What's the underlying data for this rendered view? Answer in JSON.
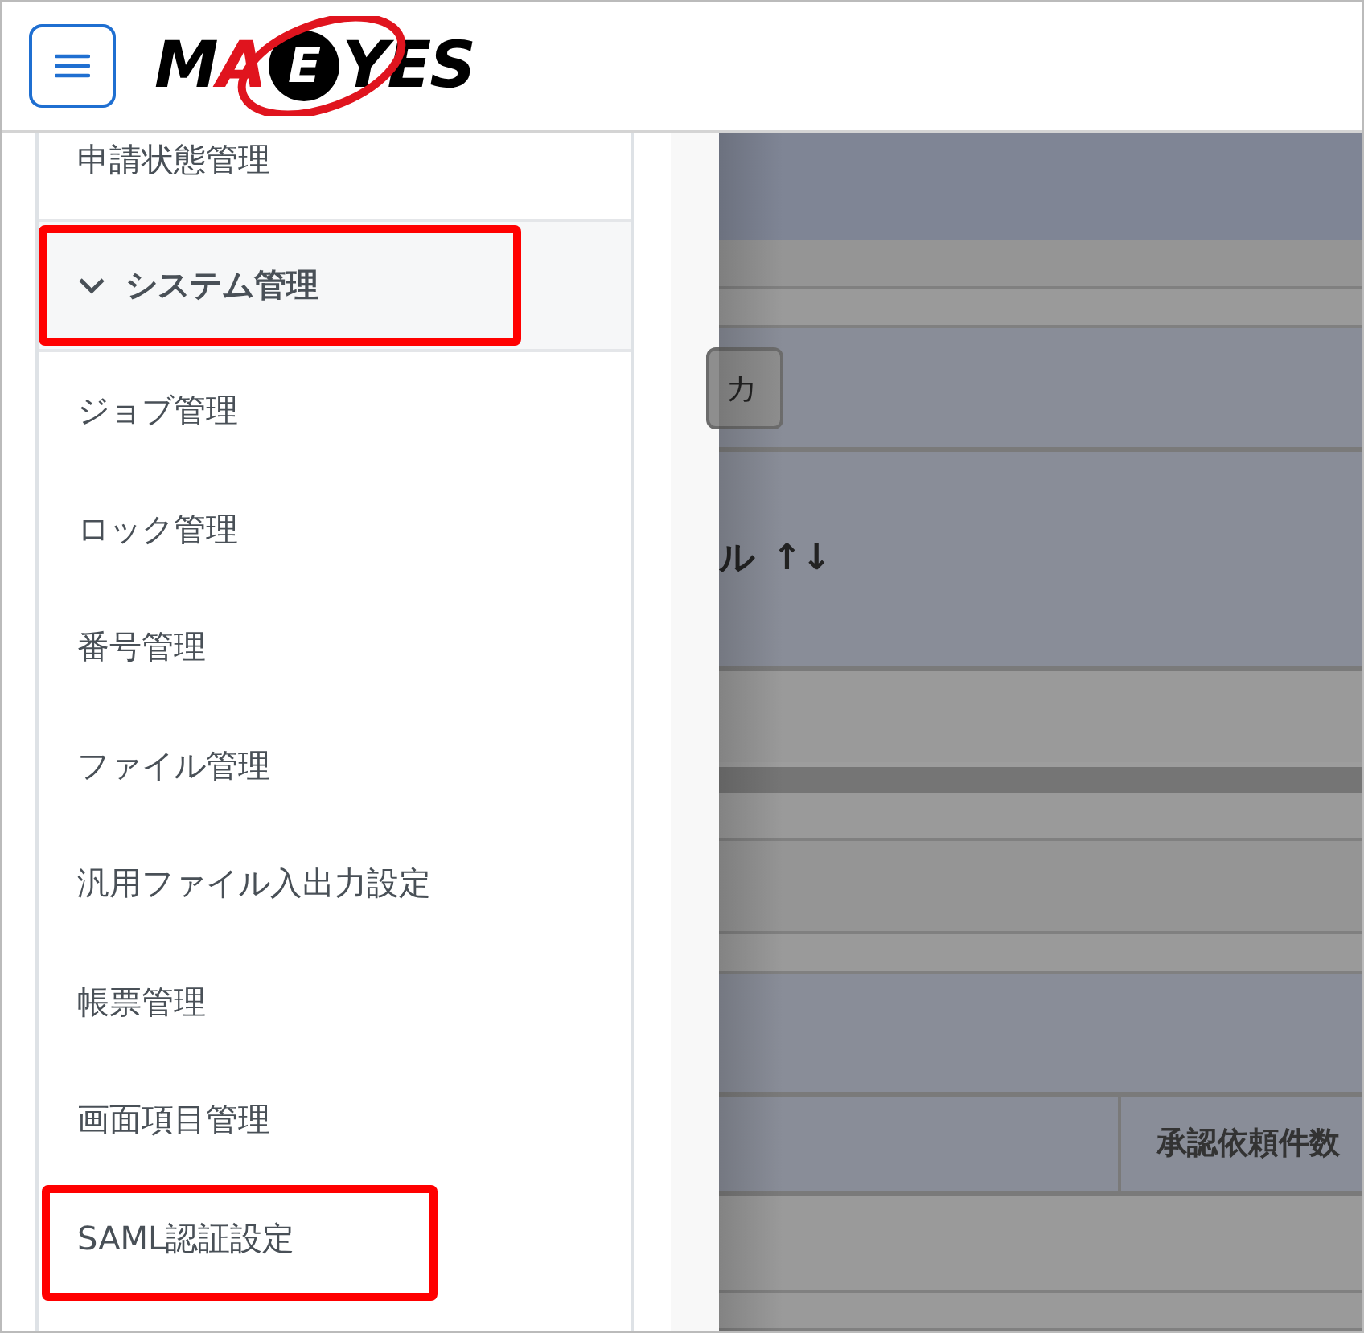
{
  "header": {
    "logo": [
      "M",
      "A",
      "E",
      "YES"
    ]
  },
  "sidebar": {
    "items": [
      {
        "label": "申請状態管理",
        "kind": "link",
        "highlighted": false
      },
      {
        "label": "システム管理",
        "kind": "section",
        "expanded": true,
        "highlighted": true
      },
      {
        "label": "ジョブ管理",
        "kind": "link",
        "highlighted": false
      },
      {
        "label": "ロック管理",
        "kind": "link",
        "highlighted": false
      },
      {
        "label": "番号管理",
        "kind": "link",
        "highlighted": false
      },
      {
        "label": "ファイル管理",
        "kind": "link",
        "highlighted": false
      },
      {
        "label": "汎用ファイル入出力設定",
        "kind": "link",
        "highlighted": false
      },
      {
        "label": "帳票管理",
        "kind": "link",
        "highlighted": false
      },
      {
        "label": "画面項目管理",
        "kind": "link",
        "highlighted": false
      },
      {
        "label": "SAML認証設定",
        "kind": "link",
        "highlighted": true
      }
    ]
  },
  "background": {
    "button_label": "カ",
    "column_header": "ル",
    "sort_icon": "↑↓",
    "table_header": "承認依頼件数"
  }
}
